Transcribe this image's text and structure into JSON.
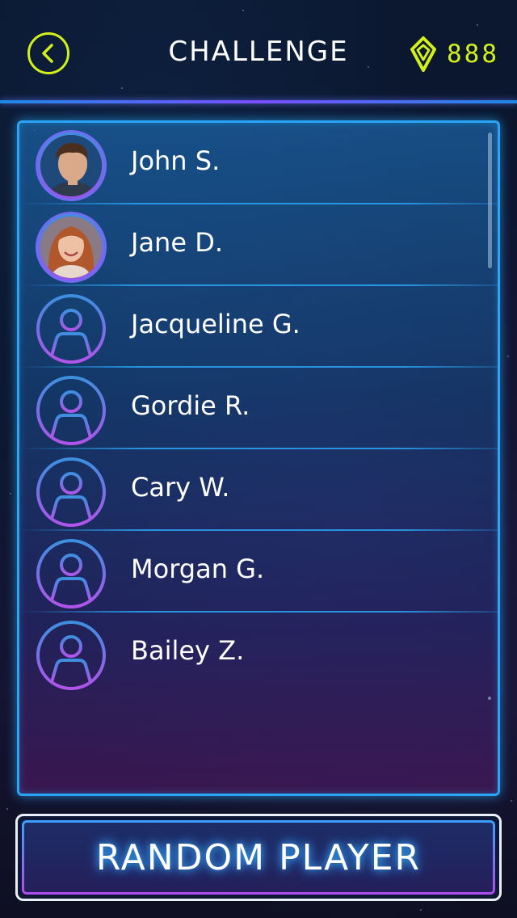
{
  "header": {
    "title": "CHALLENGE",
    "gem_count": "888",
    "back_icon": "chevron-left-icon",
    "gem_icon": "gem-icon"
  },
  "players": [
    {
      "name": "John S.",
      "avatar": "photo"
    },
    {
      "name": "Jane D.",
      "avatar": "photo"
    },
    {
      "name": "Jacqueline G.",
      "avatar": "placeholder"
    },
    {
      "name": "Gordie R.",
      "avatar": "placeholder"
    },
    {
      "name": "Cary W.",
      "avatar": "placeholder"
    },
    {
      "name": "Morgan G.",
      "avatar": "placeholder"
    },
    {
      "name": "Bailey Z.",
      "avatar": "placeholder"
    }
  ],
  "footer": {
    "random_button_label": "RANDOM PLAYER"
  },
  "colors": {
    "accent_yellow": "#d4f01a",
    "panel_border": "#2aa4f4",
    "avatar_gradient_start": "#3d8fe0",
    "avatar_gradient_end": "#9b55e8"
  }
}
